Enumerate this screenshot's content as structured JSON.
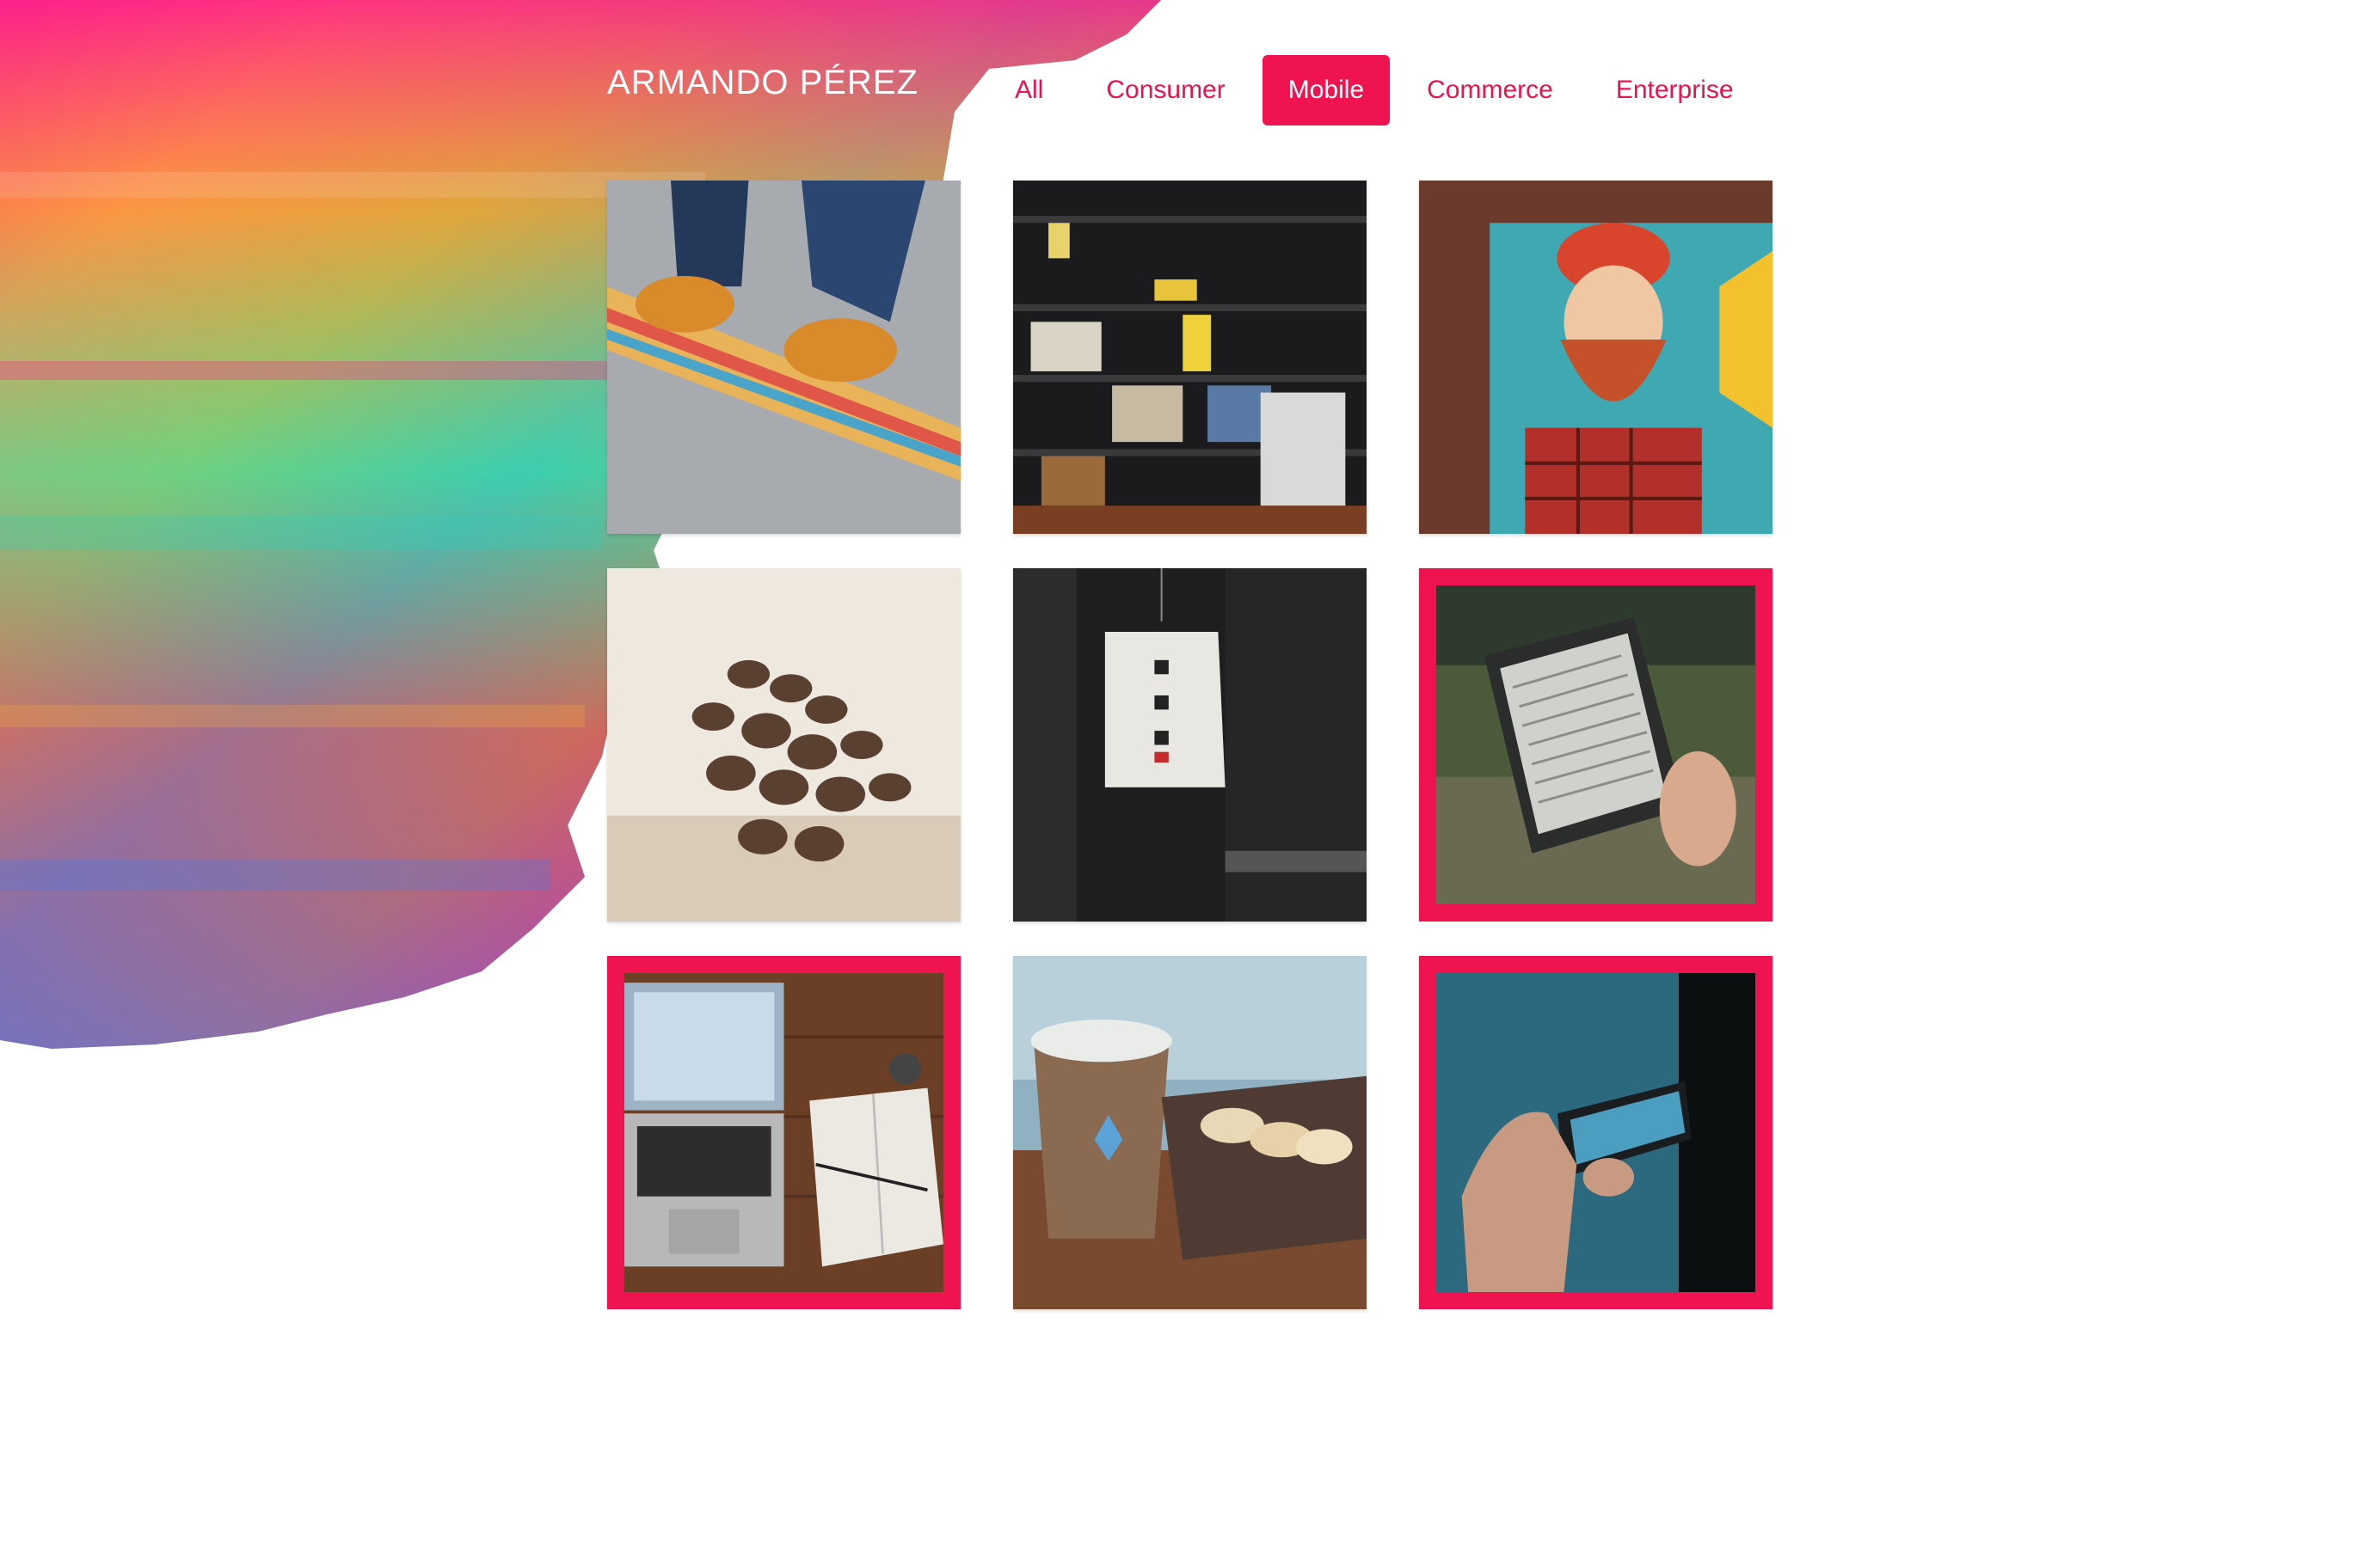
{
  "header": {
    "brand": "ARMANDO PÉREZ"
  },
  "nav": {
    "items": [
      {
        "label": "All",
        "active": false
      },
      {
        "label": "Consumer",
        "active": false
      },
      {
        "label": "Mobile",
        "active": true
      },
      {
        "label": "Commerce",
        "active": false
      },
      {
        "label": "Enterprise",
        "active": false
      }
    ]
  },
  "gallery": {
    "tiles": [
      {
        "name": "skateboard-shoes-photo",
        "selected": false
      },
      {
        "name": "bookshelf-photo",
        "selected": false
      },
      {
        "name": "bearded-man-mural-photo",
        "selected": false
      },
      {
        "name": "coffee-beans-photo",
        "selected": false
      },
      {
        "name": "paper-lantern-photo",
        "selected": false
      },
      {
        "name": "ereader-photo",
        "selected": true
      },
      {
        "name": "laptop-notebook-desk-photo",
        "selected": true
      },
      {
        "name": "coffee-cup-macarons-photo",
        "selected": false
      },
      {
        "name": "phone-in-hand-photo",
        "selected": true
      }
    ]
  },
  "colors": {
    "accent": "#ef1450",
    "background": "#ffffff"
  }
}
